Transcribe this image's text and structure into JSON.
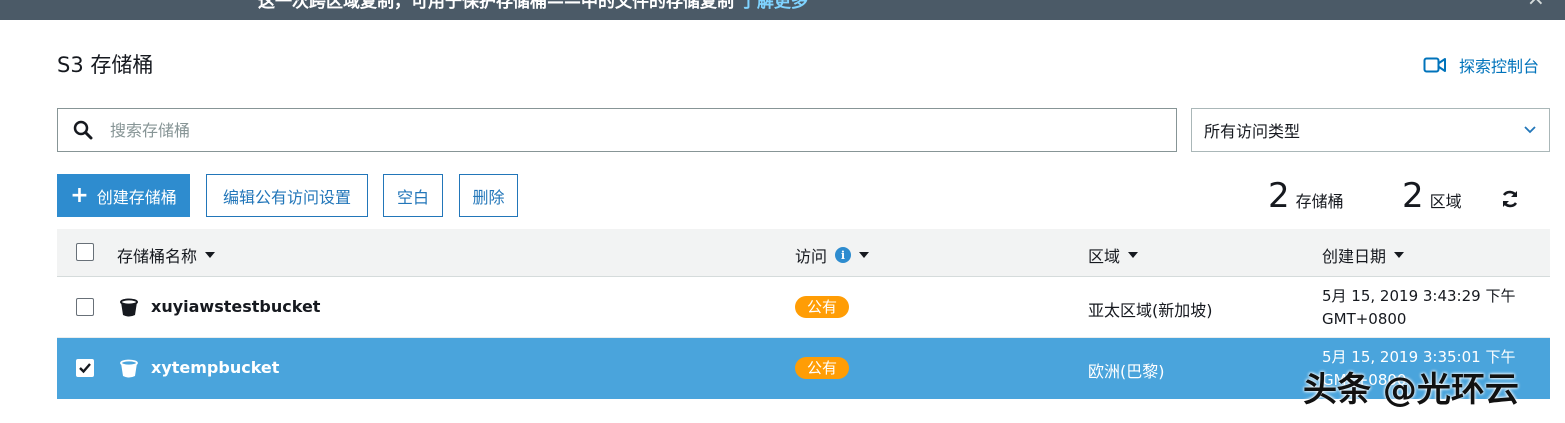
{
  "banner": {
    "text": "这一次跨区域复制，可用于保护存储桶——中的文件的存储复制",
    "link": "了解更多"
  },
  "header": {
    "title": "S3 存储桶",
    "explore_label": "探索控制台"
  },
  "search": {
    "placeholder": "搜索存储桶",
    "value": ""
  },
  "filter": {
    "selected": "所有访问类型"
  },
  "toolbar": {
    "create_label": "创建存储桶",
    "edit_public_label": "编辑公有访问设置",
    "empty_label": "空白",
    "delete_label": "删除"
  },
  "summary": {
    "bucket_count": "2",
    "bucket_unit": "存储桶",
    "region_count": "2",
    "region_unit": "区域"
  },
  "table": {
    "columns": {
      "name": "存储桶名称",
      "access": "访问",
      "region": "区域",
      "created": "创建日期"
    },
    "rows": [
      {
        "name": "xuyiawstestbucket",
        "access": "公有",
        "region": "亚太区域(新加坡)",
        "created_line1": "5月 15, 2019 3:43:29 下午",
        "created_line2": "GMT+0800",
        "selected": false
      },
      {
        "name": "xytempbucket",
        "access": "公有",
        "region": "欧洲(巴黎)",
        "created_line1": "5月 15, 2019 3:35:01 下午",
        "created_line2": "GMT+0800",
        "selected": true
      }
    ]
  },
  "watermark": {
    "text": "头条 @光环云"
  },
  "colors": {
    "primary": "#2e8ccf",
    "selected_row": "#4aa4dc",
    "badge": "#ff9d05",
    "link": "#0073bb",
    "banner_bg": "#4b5a67"
  }
}
